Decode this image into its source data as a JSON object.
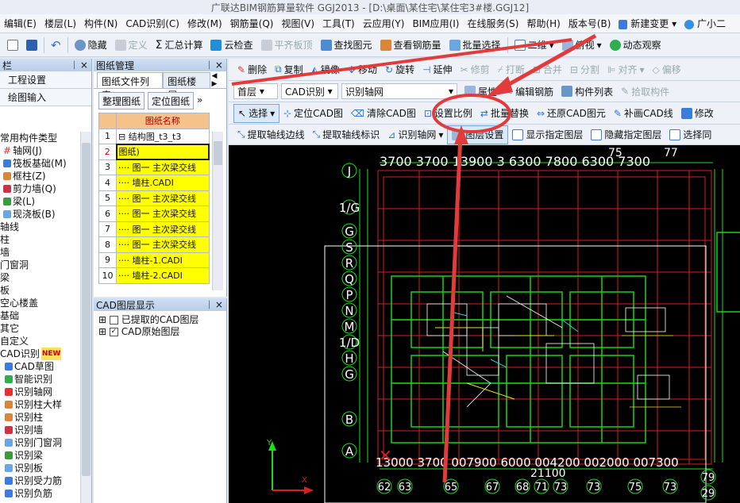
{
  "title": "广联达BIM钢筋算量软件 GGJ2013 - [D:\\桌面\\某住宅\\某住宅3#楼.GGJ12]",
  "menu": [
    "编辑(E)",
    "楼层(L)",
    "构件(N)",
    "CAD识别(C)",
    "修改(M)",
    "钢筋量(Q)",
    "视图(V)",
    "工具(T)",
    "云应用(Y)",
    "BIM应用(I)",
    "在线服务(S)",
    "帮助(H)",
    "版本号(B)",
    "新建变更",
    "广小二"
  ],
  "toolbar1": [
    "隐藏",
    "定义",
    "汇总计算",
    "云检查",
    "平齐板顶",
    "查找图元",
    "查看钢筋量",
    "批量选择",
    "二维",
    "俯视",
    "动态观察"
  ],
  "left_panel": {
    "header": "栏",
    "buttons": [
      "工程设置",
      "绘图输入"
    ],
    "tree": [
      "常用构件类型",
      "轴网(J)",
      "筏板基础(M)",
      "框柱(Z)",
      "剪力墙(Q)",
      "梁(L)",
      "现浇板(B)",
      "轴线",
      "柱",
      "墙",
      "门窗洞",
      "梁",
      "板",
      "空心楼盖",
      "基础",
      "其它",
      "自定义",
      "CAD识别",
      "CAD草图",
      "智能识别",
      "识别轴网",
      "识别柱大样",
      "识别柱",
      "识别墙",
      "识别门窗洞",
      "识别梁",
      "识别板",
      "识别受力筋",
      "识别负筋"
    ],
    "new_badge": "NEW"
  },
  "drawing_mgr": {
    "header": "图纸管理",
    "tabs": [
      "图纸文件列表",
      "图纸楼层"
    ],
    "buttons": [
      "整理图纸",
      "定位图纸"
    ],
    "col_header": "图纸名称",
    "rows": [
      {
        "n": "1",
        "name": "结构图_t3_t3"
      },
      {
        "n": "2",
        "name": "图纸)"
      },
      {
        "n": "3",
        "name": "图一 主次梁交线"
      },
      {
        "n": "4",
        "name": "墙柱.CADI"
      },
      {
        "n": "5",
        "name": "图一 主次梁交线"
      },
      {
        "n": "6",
        "name": "图一 主次梁交线"
      },
      {
        "n": "7",
        "name": "图一 主次梁交线"
      },
      {
        "n": "8",
        "name": "图一 主次梁交线"
      },
      {
        "n": "9",
        "name": "墙柱-1.CADI"
      },
      {
        "n": "10",
        "name": "墙柱-2.CADI"
      }
    ]
  },
  "cad_layer": {
    "header": "CAD图层显示",
    "items": [
      "已提取的CAD图层",
      "CAD原始图层"
    ]
  },
  "edit_toolbar": [
    "删除",
    "复制",
    "镜像",
    "移动",
    "旋转",
    "延伸",
    "修剪",
    "打断",
    "合并",
    "分割",
    "对齐",
    "偏移"
  ],
  "floor_bar": {
    "floor": "首层",
    "cad": "CAD识别",
    "mode": "识别轴网",
    "extra": [
      "属性",
      "编辑钢筋",
      "构件列表",
      "拾取构件"
    ]
  },
  "cad_toolbar": [
    "选择",
    "定位CAD图",
    "清除CAD图",
    "设置比例",
    "批量替换",
    "还原CAD图元",
    "补画CAD线",
    "修改"
  ],
  "axis_toolbar": [
    "提取轴线边线",
    "提取轴线标识",
    "识别轴网",
    "图层设置",
    "显示指定图层",
    "隐藏指定图层",
    "选择同"
  ],
  "cad_drawing": {
    "top_dims": "3700  3700  13900  3  6300  7800  6300  7300",
    "top_axes": [
      "75",
      "77"
    ],
    "left_axes": [
      "J",
      "1/G",
      "G",
      "S",
      "R",
      "Q",
      "P",
      "N",
      "M",
      "1/D",
      "H",
      "G",
      "F",
      "C",
      "B",
      "A"
    ],
    "bottom_axes": [
      "62",
      "63",
      "65",
      "67",
      "68",
      "71",
      "73",
      "73",
      "75",
      "73",
      "79",
      "29"
    ],
    "bottom_dims": "13000 3700 007900 6000 004200 002000 007300",
    "mid_dim": "21100"
  },
  "colors": {
    "accent": "#2a6fd6",
    "annotation": "#e23b3b",
    "cad_red": "#d42020",
    "cad_green": "#19e019",
    "cad_white": "#ffffff"
  }
}
